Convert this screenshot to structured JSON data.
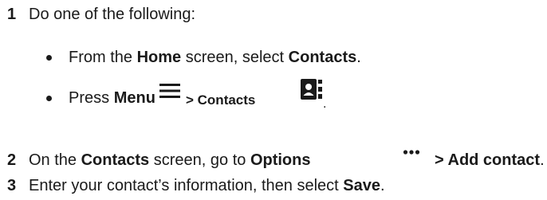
{
  "steps": [
    {
      "number": "1",
      "text": "Do one of the following:"
    },
    {
      "number": "2",
      "parts": {
        "a": "On the ",
        "b": "Contacts",
        "c": " screen, go to ",
        "d": "Options",
        "e": " > Add contact",
        "f": "."
      }
    },
    {
      "number": "3",
      "parts": {
        "a": "Enter your contact’s information, then select ",
        "b": "Save",
        "c": "."
      }
    }
  ],
  "bullets": [
    {
      "a": "From the ",
      "b": "Home",
      "c": " screen, select ",
      "d": "Contacts",
      "e": "."
    },
    {
      "a": "Press ",
      "b": "Menu",
      "c": " > Contacts",
      "d": "."
    }
  ],
  "icons": {
    "menu": "menu-icon",
    "contacts": "contacts-icon",
    "options": "more-options-icon"
  },
  "colors": {
    "text": "#1a1a1a"
  }
}
